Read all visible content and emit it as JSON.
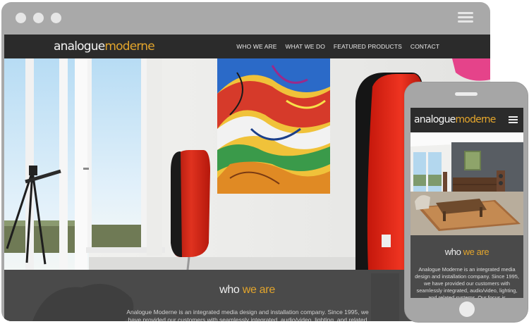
{
  "site": {
    "logo_part1": "analogue",
    "logo_part2": "moderne"
  },
  "nav": {
    "items": [
      "WHO WE ARE",
      "WHAT WE DO",
      "FEATURED PRODUCTS",
      "CONTACT"
    ]
  },
  "who_section": {
    "title_part1": "who ",
    "title_part2": "we are",
    "desktop_text": "Analogue Moderne is an integrated media design and installation company.  Since 1995, we have provided our customers with seamlessly integrated, audio/video, lighting, and related systems.  Our",
    "mobile_text": "Analogue Moderne is an integrated media design and installation company.  Since 1995, we have provided our customers with seamlessly integrated, audio/video, lighting, and related systems.  Our focus is implementing those"
  },
  "colors": {
    "accent": "#e3a52c",
    "header_bg": "#2b2b2b",
    "section_bg": "#4a4a4a",
    "device_frame": "#a9a9a9",
    "speaker_red": "#e02a1c"
  },
  "icons": {
    "desktop_menu": "hamburger-menu-icon",
    "mobile_menu": "hamburger-menu-icon"
  }
}
